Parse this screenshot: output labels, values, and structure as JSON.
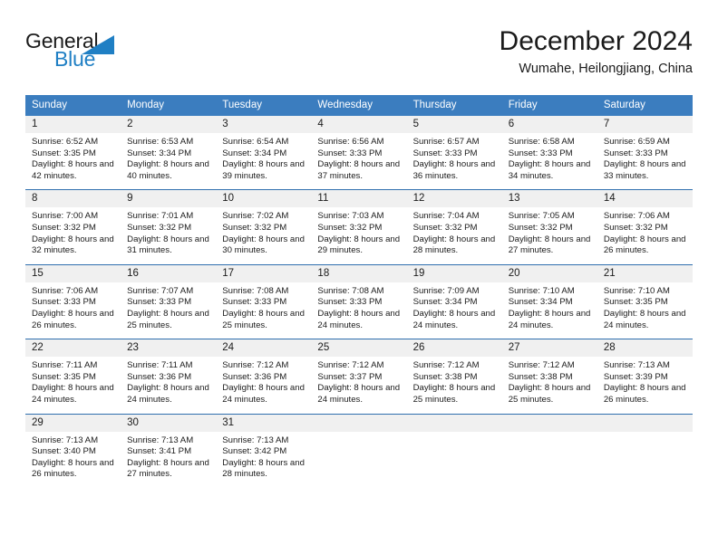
{
  "brand": {
    "name_top": "General",
    "name_bottom": "Blue",
    "accent_color": "#1f7fc4"
  },
  "header": {
    "title": "December 2024",
    "subtitle": "Wumahe, Heilongjiang, China"
  },
  "theme": {
    "header_row_blue": "#3b7dbf",
    "row_divider_blue": "#2f6fae",
    "daynum_band_gray": "#f0f0f0",
    "text_color": "#1b1b1b"
  },
  "weekday_headers": [
    "Sunday",
    "Monday",
    "Tuesday",
    "Wednesday",
    "Thursday",
    "Friday",
    "Saturday"
  ],
  "weeks": [
    [
      {
        "day": "1",
        "sunrise": "Sunrise: 6:52 AM",
        "sunset": "Sunset: 3:35 PM",
        "daylight": "Daylight: 8 hours and 42 minutes."
      },
      {
        "day": "2",
        "sunrise": "Sunrise: 6:53 AM",
        "sunset": "Sunset: 3:34 PM",
        "daylight": "Daylight: 8 hours and 40 minutes."
      },
      {
        "day": "3",
        "sunrise": "Sunrise: 6:54 AM",
        "sunset": "Sunset: 3:34 PM",
        "daylight": "Daylight: 8 hours and 39 minutes."
      },
      {
        "day": "4",
        "sunrise": "Sunrise: 6:56 AM",
        "sunset": "Sunset: 3:33 PM",
        "daylight": "Daylight: 8 hours and 37 minutes."
      },
      {
        "day": "5",
        "sunrise": "Sunrise: 6:57 AM",
        "sunset": "Sunset: 3:33 PM",
        "daylight": "Daylight: 8 hours and 36 minutes."
      },
      {
        "day": "6",
        "sunrise": "Sunrise: 6:58 AM",
        "sunset": "Sunset: 3:33 PM",
        "daylight": "Daylight: 8 hours and 34 minutes."
      },
      {
        "day": "7",
        "sunrise": "Sunrise: 6:59 AM",
        "sunset": "Sunset: 3:33 PM",
        "daylight": "Daylight: 8 hours and 33 minutes."
      }
    ],
    [
      {
        "day": "8",
        "sunrise": "Sunrise: 7:00 AM",
        "sunset": "Sunset: 3:32 PM",
        "daylight": "Daylight: 8 hours and 32 minutes."
      },
      {
        "day": "9",
        "sunrise": "Sunrise: 7:01 AM",
        "sunset": "Sunset: 3:32 PM",
        "daylight": "Daylight: 8 hours and 31 minutes."
      },
      {
        "day": "10",
        "sunrise": "Sunrise: 7:02 AM",
        "sunset": "Sunset: 3:32 PM",
        "daylight": "Daylight: 8 hours and 30 minutes."
      },
      {
        "day": "11",
        "sunrise": "Sunrise: 7:03 AM",
        "sunset": "Sunset: 3:32 PM",
        "daylight": "Daylight: 8 hours and 29 minutes."
      },
      {
        "day": "12",
        "sunrise": "Sunrise: 7:04 AM",
        "sunset": "Sunset: 3:32 PM",
        "daylight": "Daylight: 8 hours and 28 minutes."
      },
      {
        "day": "13",
        "sunrise": "Sunrise: 7:05 AM",
        "sunset": "Sunset: 3:32 PM",
        "daylight": "Daylight: 8 hours and 27 minutes."
      },
      {
        "day": "14",
        "sunrise": "Sunrise: 7:06 AM",
        "sunset": "Sunset: 3:32 PM",
        "daylight": "Daylight: 8 hours and 26 minutes."
      }
    ],
    [
      {
        "day": "15",
        "sunrise": "Sunrise: 7:06 AM",
        "sunset": "Sunset: 3:33 PM",
        "daylight": "Daylight: 8 hours and 26 minutes."
      },
      {
        "day": "16",
        "sunrise": "Sunrise: 7:07 AM",
        "sunset": "Sunset: 3:33 PM",
        "daylight": "Daylight: 8 hours and 25 minutes."
      },
      {
        "day": "17",
        "sunrise": "Sunrise: 7:08 AM",
        "sunset": "Sunset: 3:33 PM",
        "daylight": "Daylight: 8 hours and 25 minutes."
      },
      {
        "day": "18",
        "sunrise": "Sunrise: 7:08 AM",
        "sunset": "Sunset: 3:33 PM",
        "daylight": "Daylight: 8 hours and 24 minutes."
      },
      {
        "day": "19",
        "sunrise": "Sunrise: 7:09 AM",
        "sunset": "Sunset: 3:34 PM",
        "daylight": "Daylight: 8 hours and 24 minutes."
      },
      {
        "day": "20",
        "sunrise": "Sunrise: 7:10 AM",
        "sunset": "Sunset: 3:34 PM",
        "daylight": "Daylight: 8 hours and 24 minutes."
      },
      {
        "day": "21",
        "sunrise": "Sunrise: 7:10 AM",
        "sunset": "Sunset: 3:35 PM",
        "daylight": "Daylight: 8 hours and 24 minutes."
      }
    ],
    [
      {
        "day": "22",
        "sunrise": "Sunrise: 7:11 AM",
        "sunset": "Sunset: 3:35 PM",
        "daylight": "Daylight: 8 hours and 24 minutes."
      },
      {
        "day": "23",
        "sunrise": "Sunrise: 7:11 AM",
        "sunset": "Sunset: 3:36 PM",
        "daylight": "Daylight: 8 hours and 24 minutes."
      },
      {
        "day": "24",
        "sunrise": "Sunrise: 7:12 AM",
        "sunset": "Sunset: 3:36 PM",
        "daylight": "Daylight: 8 hours and 24 minutes."
      },
      {
        "day": "25",
        "sunrise": "Sunrise: 7:12 AM",
        "sunset": "Sunset: 3:37 PM",
        "daylight": "Daylight: 8 hours and 24 minutes."
      },
      {
        "day": "26",
        "sunrise": "Sunrise: 7:12 AM",
        "sunset": "Sunset: 3:38 PM",
        "daylight": "Daylight: 8 hours and 25 minutes."
      },
      {
        "day": "27",
        "sunrise": "Sunrise: 7:12 AM",
        "sunset": "Sunset: 3:38 PM",
        "daylight": "Daylight: 8 hours and 25 minutes."
      },
      {
        "day": "28",
        "sunrise": "Sunrise: 7:13 AM",
        "sunset": "Sunset: 3:39 PM",
        "daylight": "Daylight: 8 hours and 26 minutes."
      }
    ],
    [
      {
        "day": "29",
        "sunrise": "Sunrise: 7:13 AM",
        "sunset": "Sunset: 3:40 PM",
        "daylight": "Daylight: 8 hours and 26 minutes."
      },
      {
        "day": "30",
        "sunrise": "Sunrise: 7:13 AM",
        "sunset": "Sunset: 3:41 PM",
        "daylight": "Daylight: 8 hours and 27 minutes."
      },
      {
        "day": "31",
        "sunrise": "Sunrise: 7:13 AM",
        "sunset": "Sunset: 3:42 PM",
        "daylight": "Daylight: 8 hours and 28 minutes."
      },
      {
        "day": "",
        "sunrise": "",
        "sunset": "",
        "daylight": ""
      },
      {
        "day": "",
        "sunrise": "",
        "sunset": "",
        "daylight": ""
      },
      {
        "day": "",
        "sunrise": "",
        "sunset": "",
        "daylight": ""
      },
      {
        "day": "",
        "sunrise": "",
        "sunset": "",
        "daylight": ""
      }
    ]
  ]
}
